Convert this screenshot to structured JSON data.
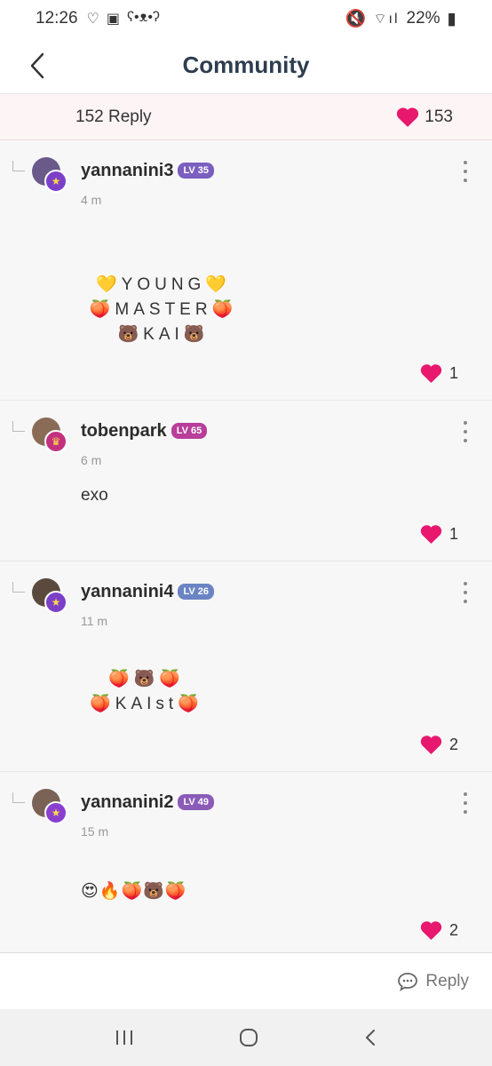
{
  "status_bar": {
    "time": "12:26",
    "battery": "22%"
  },
  "header": {
    "title": "Community"
  },
  "summary": {
    "reply_count": "152 Reply",
    "like_count": "153"
  },
  "colors": {
    "heart": "#e8186f",
    "title": "#2e3d4f"
  },
  "comments": [
    {
      "username": "yannanini3",
      "level": "LV 35",
      "level_color": "#7a5fc0",
      "time": "4 m",
      "lines": [
        "💛YOUNG💛",
        "🍑MASTER🍑",
        "🐻KAI🐻"
      ],
      "likes": "1",
      "avatar_color": "#6a5a8a",
      "badge_color": "#7b3fc8",
      "badge_icon": "star-icon"
    },
    {
      "username": "tobenpark",
      "level": "LV 65",
      "level_color": "#b83e9a",
      "time": "6 m",
      "lines": [
        "exo"
      ],
      "likes": "1",
      "avatar_color": "#8a6b55",
      "badge_color": "#c2317e",
      "badge_icon": "crown-icon"
    },
    {
      "username": "yannanini4",
      "level": "LV 26",
      "level_color": "#6b84c4",
      "time": "11 m",
      "lines": [
        "🍑🐻🍑",
        "🍑KAIst🍑"
      ],
      "likes": "2",
      "avatar_color": "#5a4a3e",
      "badge_color": "#7b3fc8",
      "badge_icon": "star-icon"
    },
    {
      "username": "yannanini2",
      "level": "LV 49",
      "level_color": "#8b5bb8",
      "time": "15 m",
      "lines": [
        "😍🔥🍑🐻🍑"
      ],
      "likes": "2",
      "avatar_color": "#7a6356",
      "badge_color": "#8a3fd0",
      "badge_icon": "star-icon"
    }
  ],
  "bottom": {
    "reply_label": "Reply"
  }
}
